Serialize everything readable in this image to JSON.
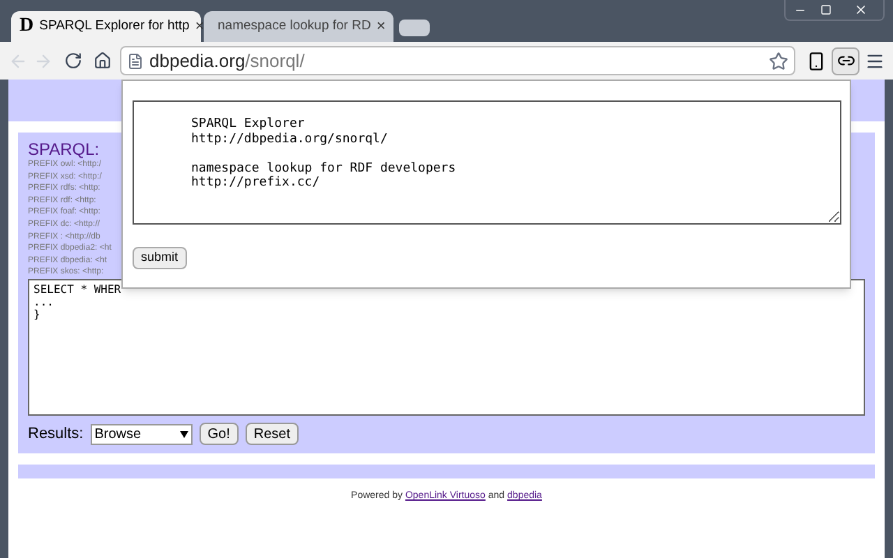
{
  "tabs": [
    {
      "title": "SPARQL Explorer for http",
      "favicon": "D",
      "kind": "letter",
      "close": "×",
      "selected": true
    },
    {
      "title": "namespace lookup for RD",
      "kind": "page",
      "close": "×",
      "selected": false
    }
  ],
  "address": {
    "domain": "dbpedia.org",
    "path": "/snorql/"
  },
  "popup": {
    "paragraphs": [
      [
        "SPARQL Explorer",
        "http://dbpedia.org/snorql/"
      ],
      [
        "namespace lookup for RDF developers",
        "http://prefix.cc/"
      ]
    ],
    "button": "submit"
  },
  "page": {
    "heading": "SPARQL:",
    "prefixes": [
      "PREFIX owl: <http:/",
      "PREFIX xsd: <http:/",
      "PREFIX rdfs: <http:",
      "PREFIX rdf: <http:",
      "PREFIX foaf: <http:",
      "PREFIX dc: <http://",
      "PREFIX : <http://db",
      "PREFIX dbpedia2: <ht",
      "PREFIX dbpedia: <ht",
      "PREFIX skos: <http:"
    ],
    "query": [
      "SELECT * WHER",
      "...",
      "}"
    ],
    "results_label": "Results:",
    "results_value": "Browse",
    "buttons": [
      "Go!",
      "Reset"
    ],
    "footer": {
      "prefix": "Powered by",
      "link1": "OpenLink Virtuoso",
      "middle": "and",
      "link2": "dbpedia"
    }
  }
}
